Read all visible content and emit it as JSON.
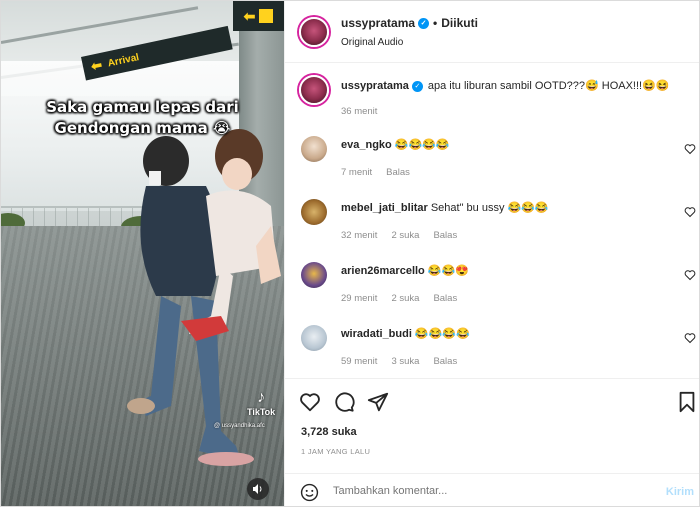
{
  "media": {
    "caption_line1": "Saka gamau lepas dari",
    "caption_line2": "Gendongan mama 😭",
    "sign_text": "Arrival",
    "sign_arrow": "⬅",
    "sign2_arrow": "⬅",
    "tiktok_label": "TikTok",
    "tiktok_handle": "@ ussyandhika.afc",
    "sound_icon": "speaker-icon"
  },
  "post": {
    "author": "ussypratama",
    "dot": "•",
    "follow_status": "Diikuti",
    "audio": "Original Audio"
  },
  "caption_comment": {
    "username": "ussypratama",
    "text": "apa itu liburan sambil OOTD???😅 HOAX!!!😆😆",
    "time": "36 menit"
  },
  "comments": [
    {
      "username": "eva_ngko",
      "text": "😂😂😂😂",
      "time": "7 menit",
      "likes": "",
      "reply": "Balas"
    },
    {
      "username": "mebel_jati_blitar",
      "text": "Sehat\" bu ussy 😂😂😂",
      "time": "32 menit",
      "likes": "2 suka",
      "reply": "Balas"
    },
    {
      "username": "arien26marcello",
      "text": "😂😂😍",
      "time": "29 menit",
      "likes": "2 suka",
      "reply": "Balas"
    },
    {
      "username": "wiradati_budi",
      "text": "😂😂😂😂",
      "time": "59 menit",
      "likes": "3 suka",
      "reply": "Balas"
    }
  ],
  "stats": {
    "likes": "3,728 suka",
    "posted": "1 JAM YANG LALU"
  },
  "compose": {
    "placeholder": "Tambahkan komentar...",
    "post_label": "Kirim"
  },
  "colors": {
    "accent": "#0095f6",
    "story_ring": "#d6249f",
    "sign_bg": "#1f2a2a",
    "sign_text": "#ffd21e"
  }
}
